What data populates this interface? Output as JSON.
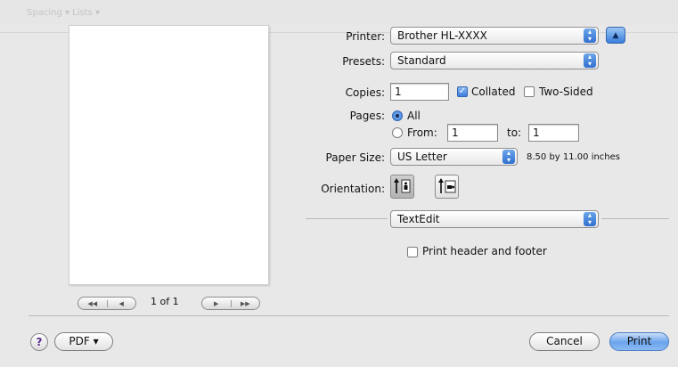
{
  "printer": {
    "label": "Printer:",
    "value": "Brother HL-XXXX"
  },
  "presets": {
    "label": "Presets:",
    "value": "Standard"
  },
  "copies": {
    "label": "Copies:",
    "value": "1",
    "collated_label": "Collated",
    "collated": true,
    "two_sided_label": "Two-Sided",
    "two_sided": false
  },
  "pages": {
    "label": "Pages:",
    "all_label": "All",
    "from_label": "From:",
    "from_value": "1",
    "to_label": "to:",
    "to_value": "1"
  },
  "paper": {
    "label": "Paper Size:",
    "value": "US Letter",
    "dimensions": "8.50 by 11.00 inches"
  },
  "orientation": {
    "label": "Orientation:",
    "options": [
      "portrait",
      "landscape"
    ],
    "selected": "portrait"
  },
  "app_menu": {
    "value": "TextEdit"
  },
  "header_footer": {
    "label": "Print header and footer",
    "checked": false
  },
  "preview": {
    "page_count": "1 of 1"
  },
  "buttons": {
    "help": "?",
    "pdf": "PDF ▾",
    "cancel": "Cancel",
    "print": "Print"
  },
  "ghost_toolbar": {
    "text": "Spacing ▾  Lists ▾"
  },
  "colors": {
    "accent": "#3a7ddd",
    "default_button": "#6ba4ec",
    "background": "#e8e8e8"
  }
}
